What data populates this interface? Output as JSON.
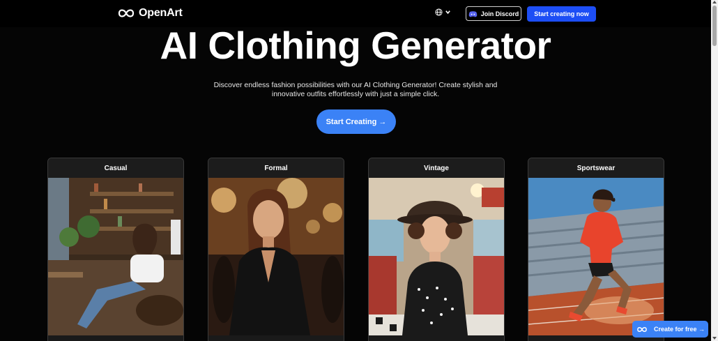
{
  "header": {
    "brand": "OpenArt",
    "join_discord": "Join Discord",
    "start_creating_now": "Start creating now"
  },
  "hero": {
    "title": "AI Clothing Generator",
    "description": "Discover endless fashion possibilities with our AI Clothing Generator! Create stylish and innovative outfits effortlessly with just a simple click.",
    "button": "Start Creating →"
  },
  "cards": [
    {
      "label": "Casual"
    },
    {
      "label": "Formal"
    },
    {
      "label": "Vintage"
    },
    {
      "label": "Sportswear"
    }
  ],
  "floating": {
    "label": "Create for free →"
  },
  "colors": {
    "accent": "#3b82f6",
    "header_cta": "#1d4ef5",
    "background": "#050505"
  },
  "icons": [
    "openart-logo-icon",
    "globe-icon",
    "chevron-down-icon",
    "discord-icon"
  ]
}
